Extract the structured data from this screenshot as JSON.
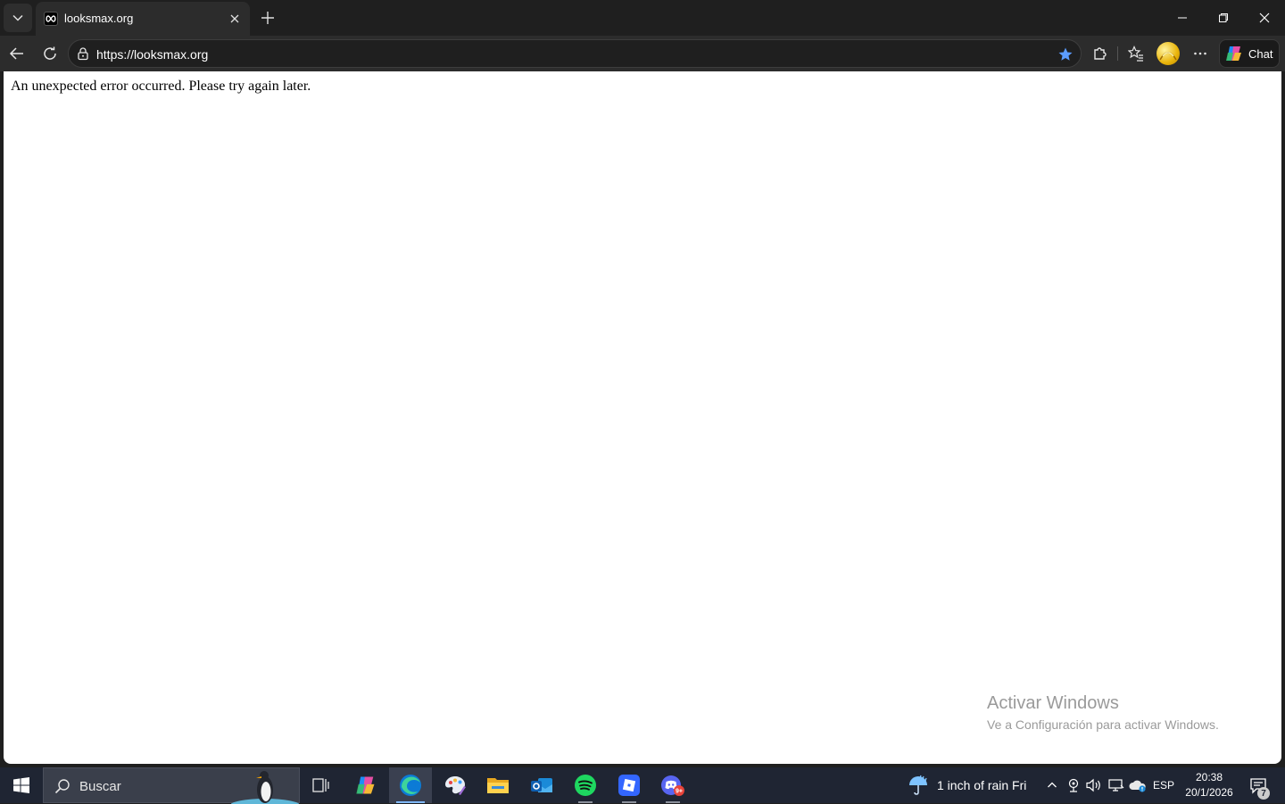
{
  "browser": {
    "tab": {
      "title": "looksmax.org",
      "favicon": "infinity-icon"
    },
    "address": {
      "url": "https://looksmax.org"
    },
    "toolbar": {
      "chat_label": "Chat"
    }
  },
  "page": {
    "error_message": "An unexpected error occurred. Please try again later."
  },
  "watermark": {
    "title": "Activar Windows",
    "subtitle": "Ve a Configuración para activar Windows."
  },
  "taskbar": {
    "search_placeholder": "Buscar",
    "apps": [
      "task-view",
      "copilot",
      "edge",
      "paint",
      "file-explorer",
      "outlook",
      "spotify",
      "roblox",
      "discord"
    ],
    "discord_badge": "9+",
    "weather": "1 inch of rain Fri",
    "language": "ESP",
    "time": "20:38",
    "date": "20/1/2026",
    "notification_count": "7"
  },
  "colors": {
    "accent": "#7fb8ff",
    "star": "#5b9cff",
    "spotify": "#1ed760",
    "discord": "#5865f2"
  }
}
